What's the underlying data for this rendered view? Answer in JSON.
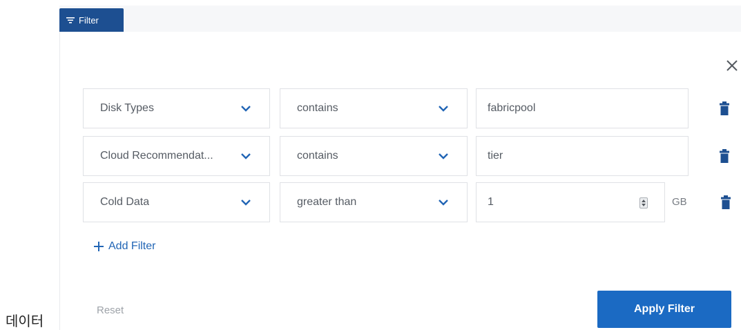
{
  "filter_tab": {
    "label": "Filter",
    "icon": "filter-lines-icon"
  },
  "close_icon": "close-icon",
  "rows": [
    {
      "field": "Disk Types",
      "operator": "contains",
      "value": "fabricpool",
      "unit": ""
    },
    {
      "field": "Cloud Recommendat...",
      "operator": "contains",
      "value": "tier",
      "unit": ""
    },
    {
      "field": "Cold Data",
      "operator": "greater than",
      "value": "1",
      "unit": "GB"
    }
  ],
  "add_filter_label": "Add Filter",
  "reset_label": "Reset",
  "apply_label": "Apply Filter",
  "side_label": "데이터",
  "colors": {
    "tab_bg": "#1d4f91",
    "accent": "#1b6ac3",
    "link": "#2165b5",
    "chevron": "#2165b5",
    "trash": "#1d4f91"
  }
}
